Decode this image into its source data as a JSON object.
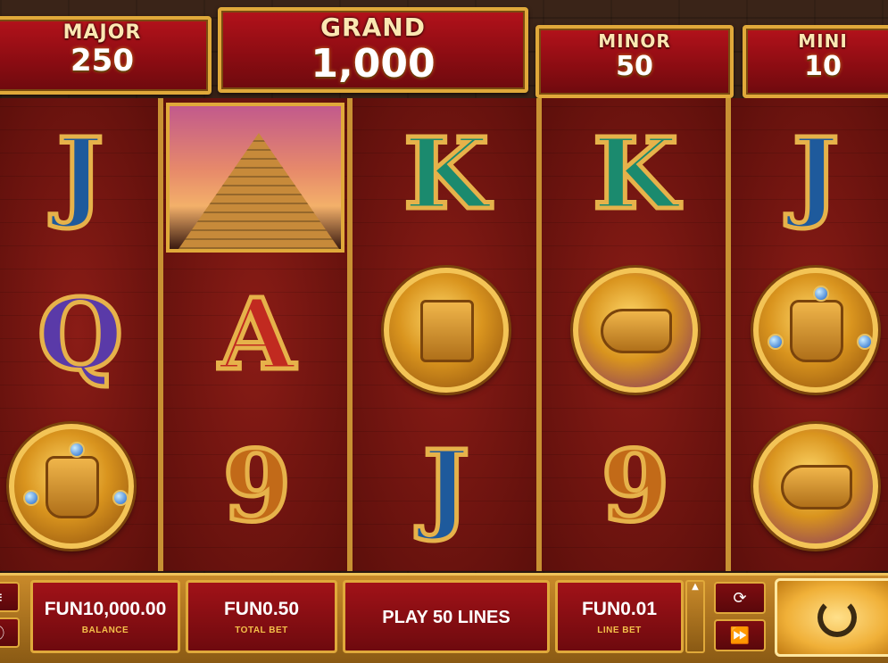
{
  "jackpots": {
    "major": {
      "label": "MAJOR",
      "value": "250"
    },
    "grand": {
      "label": "GRAND",
      "value": "1,000"
    },
    "minor": {
      "label": "MINOR",
      "value": "50"
    },
    "mini": {
      "label": "MINI",
      "value": "10"
    }
  },
  "reels": [
    [
      "J",
      "Q",
      "inca-medal"
    ],
    [
      "pyramid",
      "A",
      "9"
    ],
    [
      "K",
      "mask-medal",
      "J"
    ],
    [
      "K",
      "serpent-medal",
      "9"
    ],
    [
      "J",
      "inca-medal",
      "serpent-medal"
    ]
  ],
  "controls": {
    "balance": {
      "value": "FUN10,000.00",
      "caption": "BALANCE"
    },
    "total_bet": {
      "value": "FUN0.50",
      "caption": "TOTAL BET"
    },
    "play_lines": "PLAY 50 LINES",
    "line_bet": {
      "value": "FUN0.01",
      "caption": "LINE BET"
    }
  },
  "icons": {
    "menu": "menu-icon",
    "info": "info-icon",
    "autoplay": "autoplay-icon",
    "turbo": "fast-forward-icon",
    "spin": "spin-icon",
    "stepper": "chevron-up-icon"
  },
  "colors": {
    "accent_gold": "#e0a93a",
    "panel_red": "#a11218",
    "spin_gold": "#f0b038"
  }
}
